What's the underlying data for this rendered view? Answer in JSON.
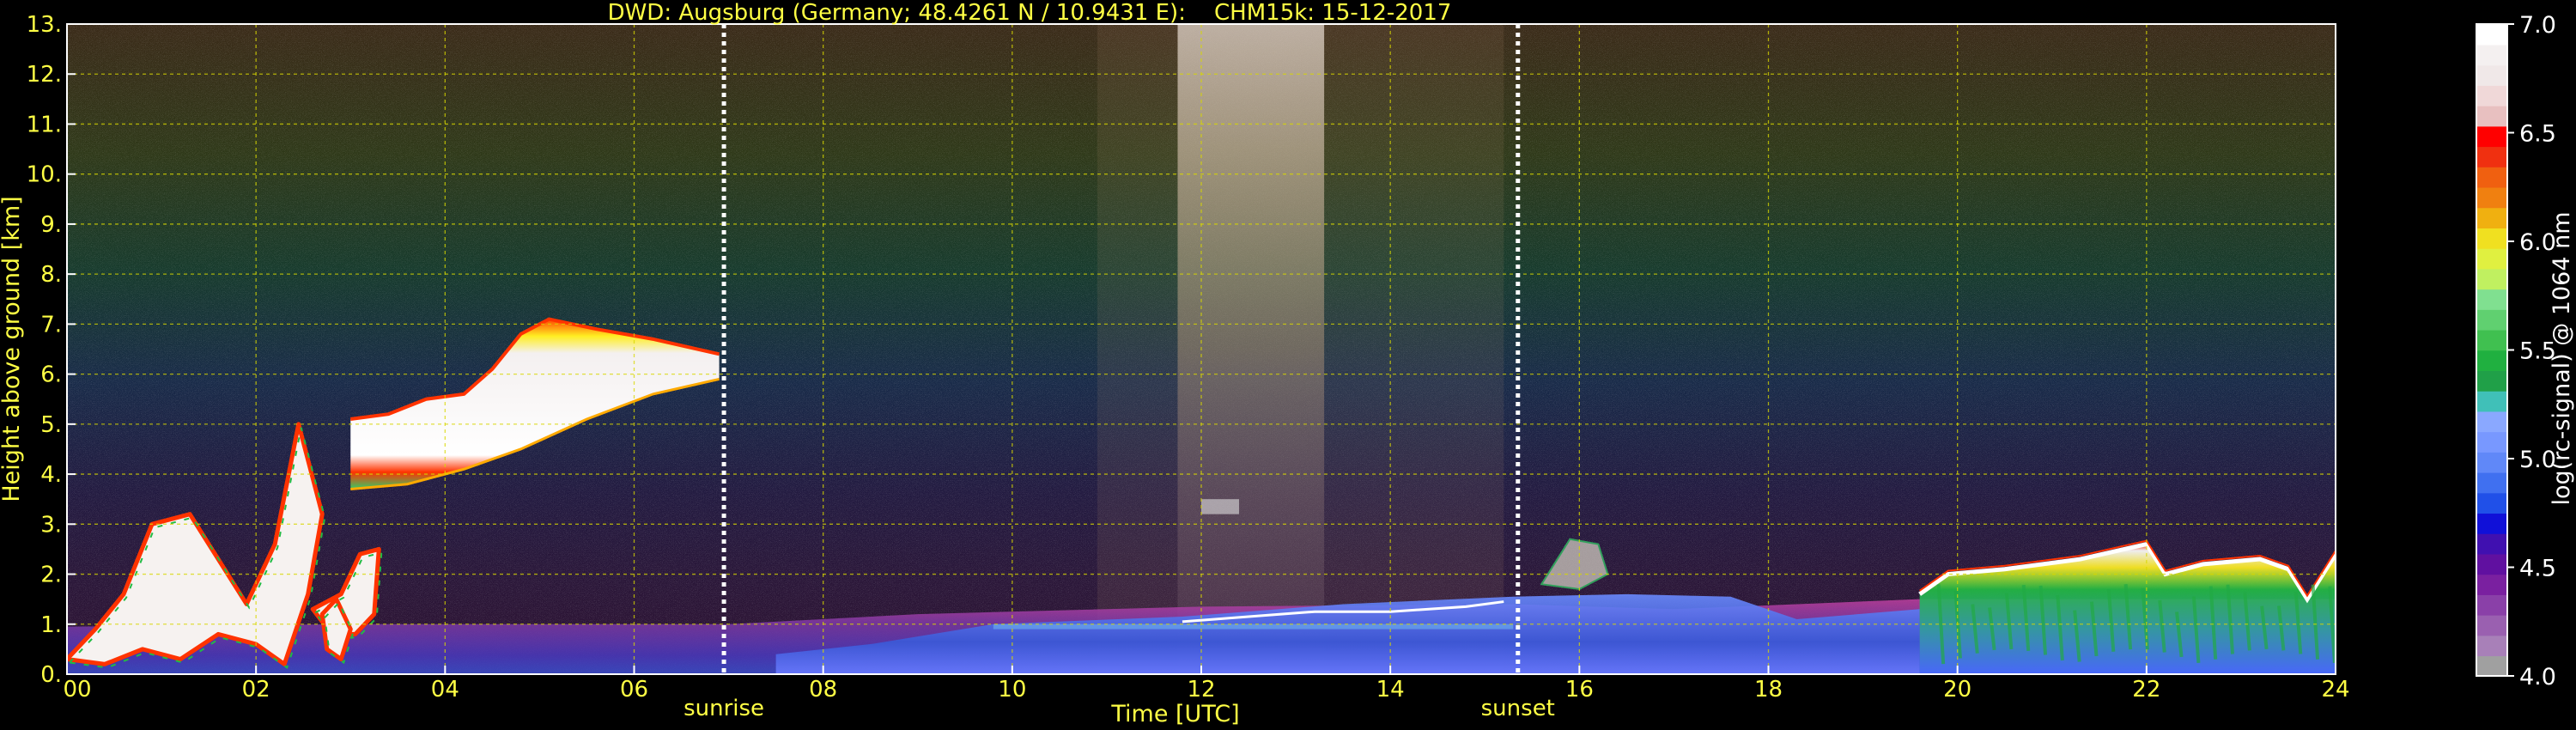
{
  "chart_data": {
    "type": "heatmap",
    "title": "DWD: Augsburg (Germany; 48.4261 N / 10.9431 E):    CHM15k: 15-12-2017",
    "xlabel": "Time [UTC]",
    "ylabel": "Height above ground [km]",
    "xlim": [
      0,
      24
    ],
    "ylim": [
      0,
      13
    ],
    "x_ticks": [
      "00",
      "02",
      "04",
      "06",
      "08",
      "10",
      "12",
      "14",
      "16",
      "18",
      "20",
      "22",
      "24"
    ],
    "y_ticks": [
      "0.",
      "1.",
      "2.",
      "3.",
      "4.",
      "5.",
      "6.",
      "7.",
      "8.",
      "9.",
      "10.",
      "11.",
      "12.",
      "13."
    ],
    "grid": true,
    "events": [
      {
        "label": "sunrise",
        "time": 6.95
      },
      {
        "label": "sunset",
        "time": 15.35
      }
    ],
    "colorbar": {
      "label": "log(rc-signal) @ 1064 nm",
      "range": [
        4.0,
        7.0
      ],
      "ticks": [
        "4.0",
        "4.5",
        "5.0",
        "5.5",
        "6.0",
        "6.5",
        "7.0"
      ]
    },
    "features": [
      {
        "name": "mid-level cloud layer",
        "t_start": 3.0,
        "t_end": 6.9,
        "base_km_start": 3.7,
        "base_km_end": 6.0,
        "top_km_start": 5.1,
        "top_km_end": 7.1
      },
      {
        "name": "low cloud / convective cells",
        "t_start": 0.0,
        "t_end": 3.2,
        "base_km": 0.0,
        "top_km": 5.0
      },
      {
        "name": "boundary layer aerosol",
        "t_start": 0.0,
        "t_end": 24.0,
        "top_km_start": 0.9,
        "top_km_end": 1.4
      },
      {
        "name": "evening low cloud",
        "t_start": 19.6,
        "t_end": 24.0,
        "base_km": 0.0,
        "top_km": 2.6
      },
      {
        "name": "noon high-signal noise column",
        "t_start": 11.8,
        "t_end": 13.2,
        "base_km": 0.0,
        "top_km": 13.0
      }
    ]
  }
}
